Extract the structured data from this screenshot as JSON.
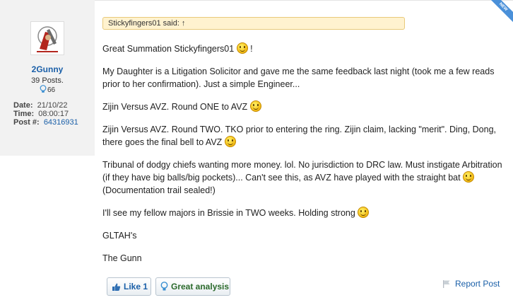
{
  "ribbon": {
    "label": "NEW"
  },
  "author": {
    "username": "2Gunny",
    "posts": "39 Posts.",
    "likes": "66",
    "date_label": "Date:",
    "date_value": "21/10/22",
    "time_label": "Time:",
    "time_value": "08:00:17",
    "post_label": "Post #:",
    "post_value": "64316931"
  },
  "quote": {
    "text": "Stickyfingers01 said: ↑"
  },
  "post": {
    "p1": "Great Summation Stickyfingers01",
    "p1_tail": "!",
    "p2": "My Daughter is a Litigation Solicitor and gave me the same feedback last night (took me a few reads prior to her confirmation). Just a simple Engineer...",
    "p3": "Zijin Versus AVZ. Round ONE to AVZ",
    "p4": "Zijin Versus AVZ. Round TWO. TKO prior to entering the ring. Zijin claim, lacking \"merit\". Ding, Dong, there goes the final bell to AVZ",
    "p5a": "Tribunal of dodgy chiefs wanting more money. lol. No jurisdiction to DRC law. Must instigate Arbitration (if they have big balls/big pockets)... Can't see this, as AVZ have played with the straight bat",
    "p5b": "(Documentation trail sealed!)",
    "p6": "I'll see my fellow majors in Brissie in TWO weeks. Holding strong",
    "p7": "GLTAH's",
    "p8": "The Gunn"
  },
  "actions": {
    "like_label": "Like 1",
    "analysis_label": "Great analysis",
    "report_label": "Report Post"
  }
}
